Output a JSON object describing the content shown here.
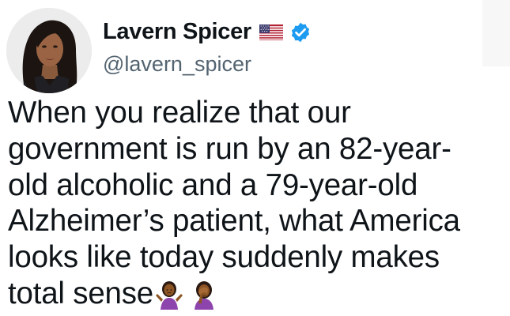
{
  "tweet": {
    "author": {
      "name": "Lavern Spicer",
      "handle": "@lavern_spicer",
      "flag_icon": "us-flag-icon",
      "verified_icon": "verified-badge-icon",
      "verified_color": "#1d9bf0"
    },
    "text_lines": [
      "When you realize that our",
      "government is run by an 82-year-",
      "old alcoholic and a 79-year-old",
      "Alzheimer’s patient, what America",
      "looks like today suddenly makes",
      "total sense"
    ],
    "emojis": [
      "person-shrugging-icon",
      "person-facepalming-icon"
    ]
  }
}
